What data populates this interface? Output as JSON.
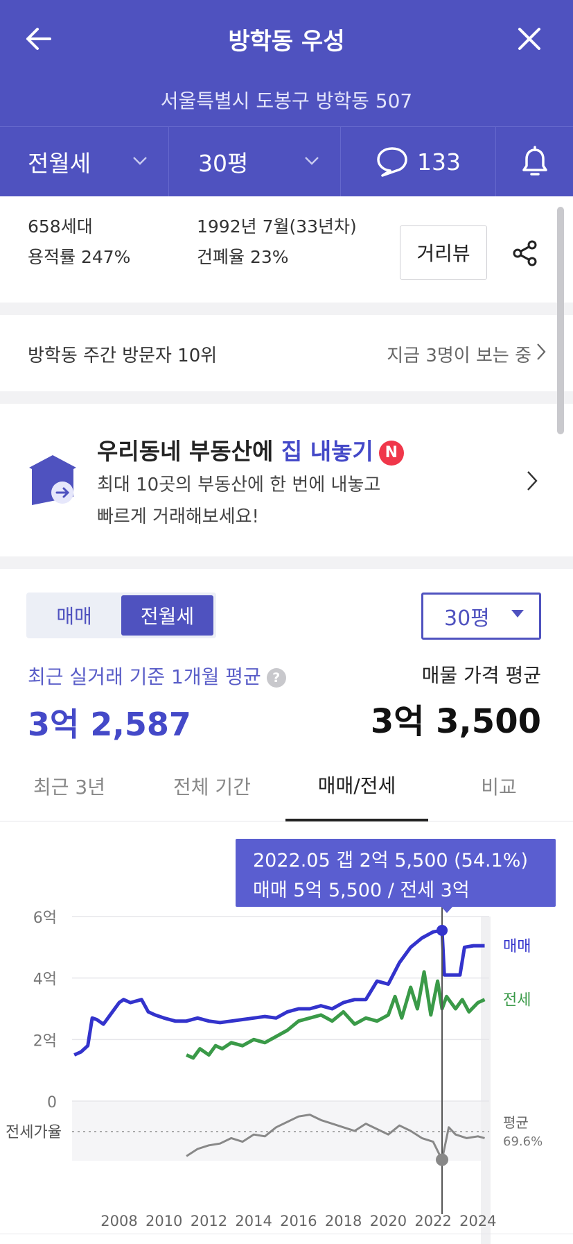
{
  "header": {
    "title": "방학동 우성",
    "address": "서울특별시 도봉구 방학동 507",
    "filters": {
      "trade_type": "전월세",
      "size": "30평",
      "comment_count": "133"
    }
  },
  "info": {
    "households": "658세대",
    "floor_area_ratio": "용적률 247%",
    "built": "1992년 7월(33년차)",
    "coverage_ratio": "건폐율 23%",
    "street_view_label": "거리뷰"
  },
  "rank": {
    "text": "방학동 주간 방문자 10위",
    "viewers": "지금 3명이 보는 중"
  },
  "promo": {
    "title_plain": "우리동네 부동산에 ",
    "title_highlight": "집 내놓기",
    "badge": "N",
    "desc_line1": "최대 10곳의 부동산에 한 번에 내놓고",
    "desc_line2": "빠르게 거래해보세요!"
  },
  "price": {
    "toggle": {
      "sale": "매매",
      "rent": "전월세"
    },
    "size_select": "30평",
    "recent_avg_label": "최근 실거래 기준 1개월 평균",
    "help": "?",
    "recent_avg_value": "3억 2,587",
    "listing_avg_label": "매물 가격 평균",
    "listing_avg_value": "3억 3,500"
  },
  "tabs": [
    "최근 3년",
    "전체 기간",
    "매매/전세",
    "비교"
  ],
  "tooltip": {
    "line1": "2022.05  갭 2억 5,500 (54.1%)",
    "line2": "매매 5억 5,500 / 전세 3억"
  },
  "colors": {
    "brand": "#4f52bf",
    "sale": "#3333cc",
    "jeonse": "#3a9a48",
    "ratio": "#888888"
  },
  "chart_data": {
    "type": "line",
    "y_ticks": [
      "6억",
      "4억",
      "2억",
      "0"
    ],
    "ylim": [
      0,
      6
    ],
    "x_ticks": [
      "2008",
      "2010",
      "2012",
      "2014",
      "2016",
      "2018",
      "2020",
      "2022",
      "2024"
    ],
    "xlim": [
      2005.9,
      2024.5
    ],
    "ratio_label": "전세가율",
    "ratio_avg_label": "평균",
    "ratio_avg_value": "69.6%",
    "series": [
      {
        "name": "매매",
        "x": [
          2006.0,
          2006.3,
          2006.6,
          2006.8,
          2007.0,
          2007.3,
          2007.6,
          2008.0,
          2008.2,
          2008.5,
          2009.0,
          2009.3,
          2009.6,
          2010.0,
          2010.5,
          2011.0,
          2011.5,
          2012.0,
          2012.5,
          2013.0,
          2013.5,
          2014.0,
          2014.5,
          2015.0,
          2015.5,
          2016.0,
          2016.5,
          2017.0,
          2017.5,
          2018.0,
          2018.5,
          2019.0,
          2019.5,
          2020.0,
          2020.5,
          2021.0,
          2021.5,
          2022.0,
          2022.4,
          2022.5,
          2023.0,
          2023.2,
          2023.4,
          2023.8,
          2024.3
        ],
        "values": [
          1.5,
          1.6,
          1.8,
          2.7,
          2.65,
          2.5,
          2.8,
          3.2,
          3.3,
          3.2,
          3.3,
          2.9,
          2.8,
          2.7,
          2.6,
          2.6,
          2.7,
          2.6,
          2.55,
          2.6,
          2.65,
          2.7,
          2.75,
          2.7,
          2.9,
          3.0,
          3.0,
          3.1,
          3.0,
          3.2,
          3.3,
          3.3,
          3.9,
          3.8,
          4.5,
          5.0,
          5.3,
          5.5,
          5.55,
          4.1,
          4.1,
          4.1,
          5.0,
          5.05,
          5.05
        ]
      },
      {
        "name": "전세",
        "x": [
          2011.0,
          2011.3,
          2011.6,
          2012.0,
          2012.3,
          2012.6,
          2013.0,
          2013.5,
          2014.0,
          2014.5,
          2015.0,
          2015.5,
          2016.0,
          2016.5,
          2017.0,
          2017.5,
          2018.0,
          2018.5,
          2019.0,
          2019.5,
          2020.0,
          2020.3,
          2020.6,
          2021.0,
          2021.3,
          2021.6,
          2021.9,
          2022.2,
          2022.4,
          2022.6,
          2023.0,
          2023.3,
          2023.6,
          2024.0,
          2024.3
        ],
        "values": [
          1.5,
          1.4,
          1.7,
          1.5,
          1.8,
          1.7,
          1.9,
          1.8,
          2.0,
          1.9,
          2.1,
          2.3,
          2.6,
          2.7,
          2.8,
          2.6,
          2.9,
          2.5,
          2.7,
          2.6,
          2.8,
          3.4,
          2.7,
          3.7,
          3.0,
          4.2,
          2.8,
          3.9,
          3.0,
          3.4,
          3.0,
          3.3,
          2.9,
          3.2,
          3.3
        ]
      },
      {
        "name": "전세가율",
        "x": [
          2011.0,
          2011.5,
          2012.0,
          2012.5,
          2013.0,
          2013.5,
          2014.0,
          2014.5,
          2015.0,
          2015.5,
          2016.0,
          2016.5,
          2017.0,
          2017.5,
          2018.0,
          2018.5,
          2019.0,
          2019.5,
          2020.0,
          2020.5,
          2021.0,
          2021.5,
          2022.0,
          2022.4,
          2022.7,
          2023.0,
          2023.5,
          2024.0,
          2024.3
        ],
        "values": [
          56,
          60,
          62,
          63,
          66,
          64,
          68,
          67,
          72,
          75,
          78,
          79,
          76,
          74,
          72,
          70,
          74,
          71,
          68,
          73,
          70,
          66,
          64,
          54,
          72,
          68,
          66,
          67,
          66
        ]
      }
    ],
    "tooltip_point": {
      "x": 2022.4,
      "sale": 5.55,
      "jeonse": 3.0,
      "gap": "2억 5,500",
      "gap_pct": 54.1
    }
  }
}
